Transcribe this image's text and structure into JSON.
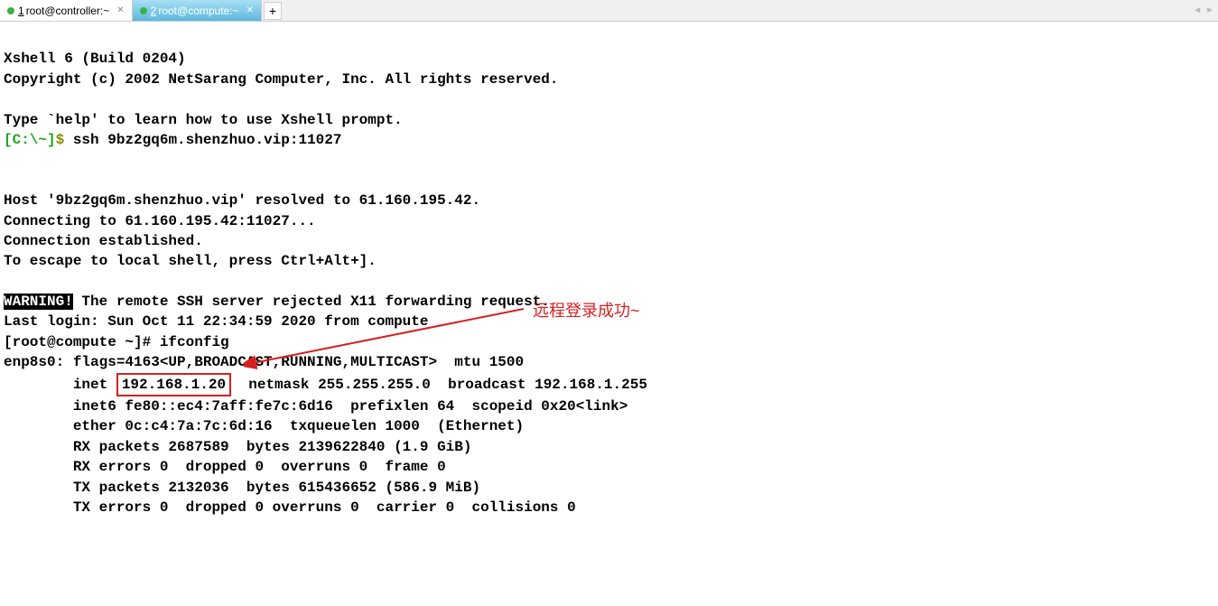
{
  "tabs": {
    "tab1": {
      "num": "1",
      "label": "root@controller:~"
    },
    "tab2": {
      "num": "2",
      "label": "root@compute:~"
    }
  },
  "header": {
    "line1": "Xshell 6 (Build 0204)",
    "line2": "Copyright (c) 2002 NetSarang Computer, Inc. All rights reserved.",
    "line4": "Type `help' to learn how to use Xshell prompt."
  },
  "prompt": {
    "c": "[C:\\~]",
    "dollar": "$",
    "cmd": "ssh 9bz2gq6m.shenzhuo.vip:11027"
  },
  "conn": {
    "l1": "Host '9bz2gq6m.shenzhuo.vip' resolved to 61.160.195.42.",
    "l2": "Connecting to 61.160.195.42:11027...",
    "l3": "Connection established.",
    "l4": "To escape to local shell, press Ctrl+Alt+]."
  },
  "warning": {
    "tag": "WARNING!",
    "msg": " The remote SSH server rejected X11 forwarding request."
  },
  "login": {
    "last": "Last login: Sun Oct 11 22:34:59 2020 from compute",
    "prompt": "[root@compute ~]# ifconfig"
  },
  "ifconfig": {
    "l1": "enp8s0: flags=4163<UP,BROADCAST,RUNNING,MULTICAST>  mtu 1500",
    "l2a": "        inet ",
    "l2box": "192.168.1.20",
    "l2b": "  netmask 255.255.255.0  broadcast 192.168.1.255",
    "l3": "        inet6 fe80::ec4:7aff:fe7c:6d16  prefixlen 64  scopeid 0x20<link>",
    "l4": "        ether 0c:c4:7a:7c:6d:16  txqueuelen 1000  (Ethernet)",
    "l5": "        RX packets 2687589  bytes 2139622840 (1.9 GiB)",
    "l6": "        RX errors 0  dropped 0  overruns 0  frame 0",
    "l7": "        TX packets 2132036  bytes 615436652 (586.9 MiB)",
    "l8": "        TX errors 0  dropped 0 overruns 0  carrier 0  collisions 0"
  },
  "annotation": "远程登录成功~"
}
